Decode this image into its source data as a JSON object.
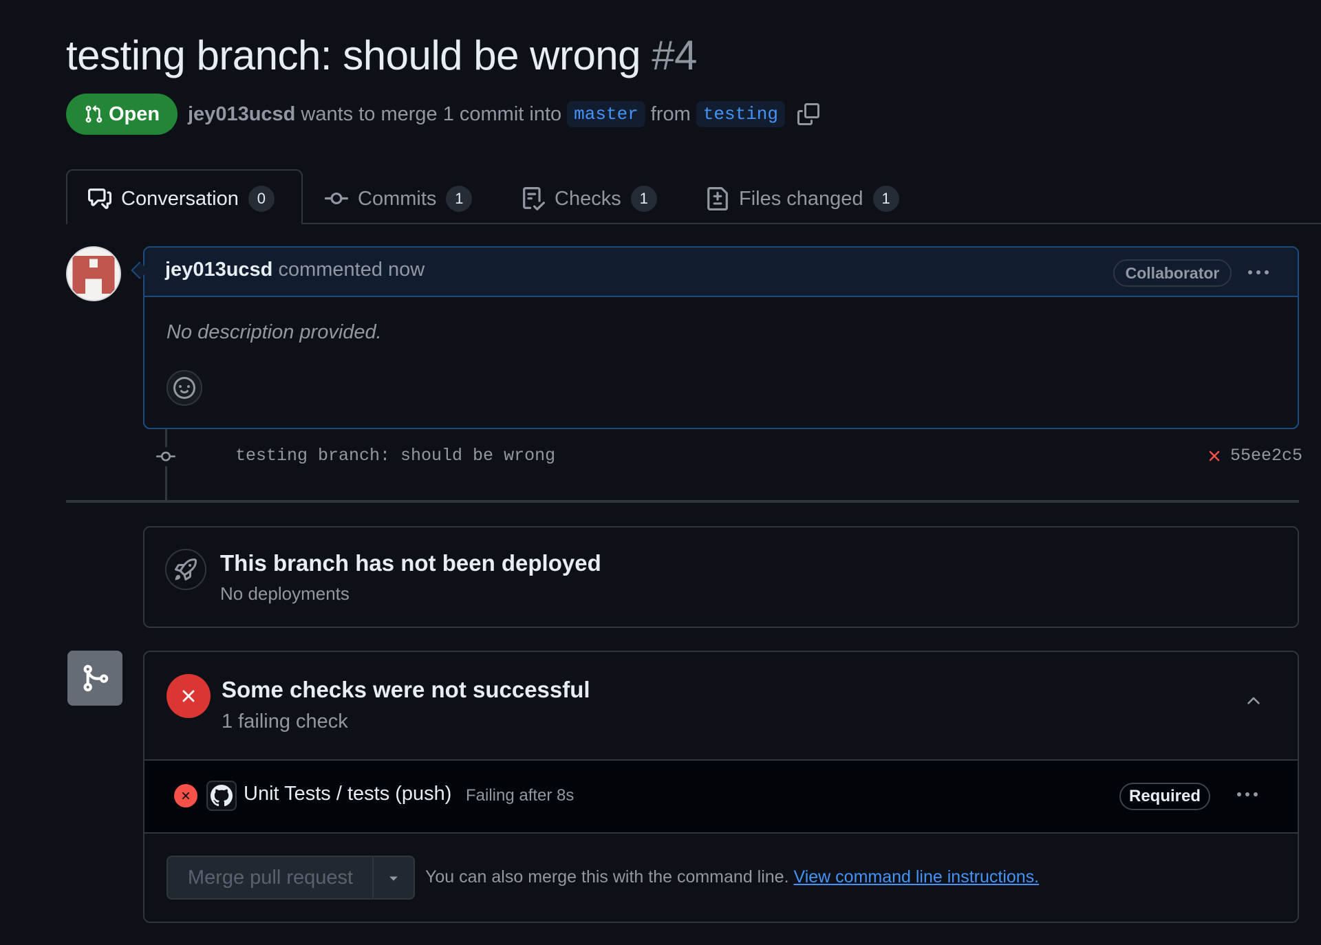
{
  "pr": {
    "title": "testing branch: should be wrong",
    "number": "#4",
    "state": "Open",
    "author": "jey013ucsd",
    "merge_text": "wants to merge 1 commit into",
    "base_branch": "master",
    "from_text": "from",
    "head_branch": "testing"
  },
  "tabs": [
    {
      "label": "Conversation",
      "count": "0",
      "icon": "comment-discussion-icon"
    },
    {
      "label": "Commits",
      "count": "1",
      "icon": "git-commit-icon"
    },
    {
      "label": "Checks",
      "count": "1",
      "icon": "checklist-icon"
    },
    {
      "label": "Files changed",
      "count": "1",
      "icon": "file-diff-icon"
    }
  ],
  "comment": {
    "author": "jey013ucsd",
    "action": "commented now",
    "role_badge": "Collaborator",
    "body": "No description provided."
  },
  "commit": {
    "message": "testing branch: should be wrong",
    "sha": "55ee2c5",
    "status": "failed"
  },
  "deployment": {
    "title": "This branch has not been deployed",
    "subtitle": "No deployments"
  },
  "checks": {
    "title": "Some checks were not successful",
    "subtitle": "1 failing check",
    "items": [
      {
        "name": "Unit Tests / tests (push)",
        "status": "Failing after 8s",
        "badge": "Required"
      }
    ]
  },
  "merge": {
    "button_label": "Merge pull request",
    "hint": "You can also merge this with the command line.",
    "link": "View command line instructions."
  },
  "colors": {
    "background": "#0d1117",
    "open_green": "#238636",
    "fail_red": "#da3633",
    "link_blue": "#4493f8"
  }
}
